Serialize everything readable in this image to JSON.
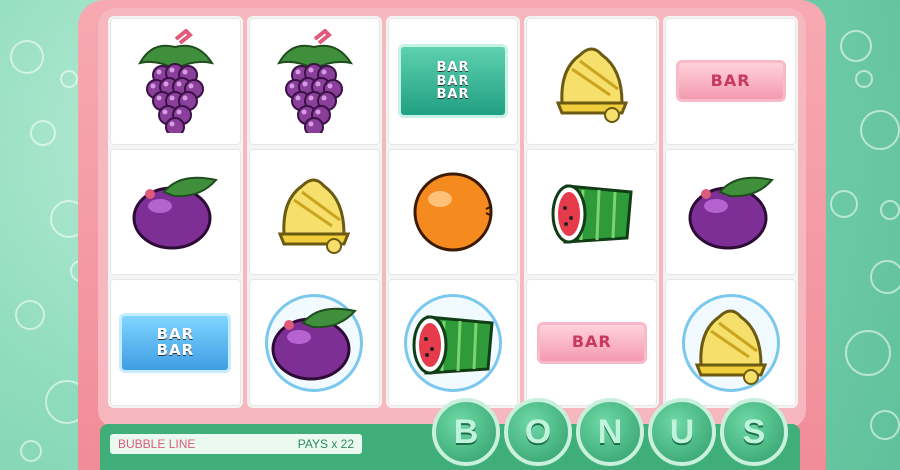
{
  "reels": [
    [
      "grapes",
      "plum",
      "bar-double"
    ],
    [
      "grapes",
      "bell",
      "plum"
    ],
    [
      "bar-triple",
      "orange",
      "watermelon"
    ],
    [
      "bell",
      "watermelon",
      "bar-single"
    ],
    [
      "bar-single",
      "plum",
      "bell"
    ]
  ],
  "bubble_cells": [
    "0-3",
    "1-2",
    "2-2",
    "4-2"
  ],
  "bar_text": {
    "single": "BAR",
    "double": [
      "BAR",
      "BAR"
    ],
    "triple": [
      "BAR",
      "BAR",
      "BAR"
    ]
  },
  "info": {
    "line_label": "BUBBLE LINE",
    "pays": "PAYS x 22"
  },
  "bonus_letters": [
    "B",
    "O",
    "N",
    "U",
    "S"
  ],
  "colors": {
    "cabinet": "#f08c98",
    "background": "#8fdcbc",
    "bottom_bar": "#3fae78",
    "bubble_ring": "#7bc8ee"
  }
}
